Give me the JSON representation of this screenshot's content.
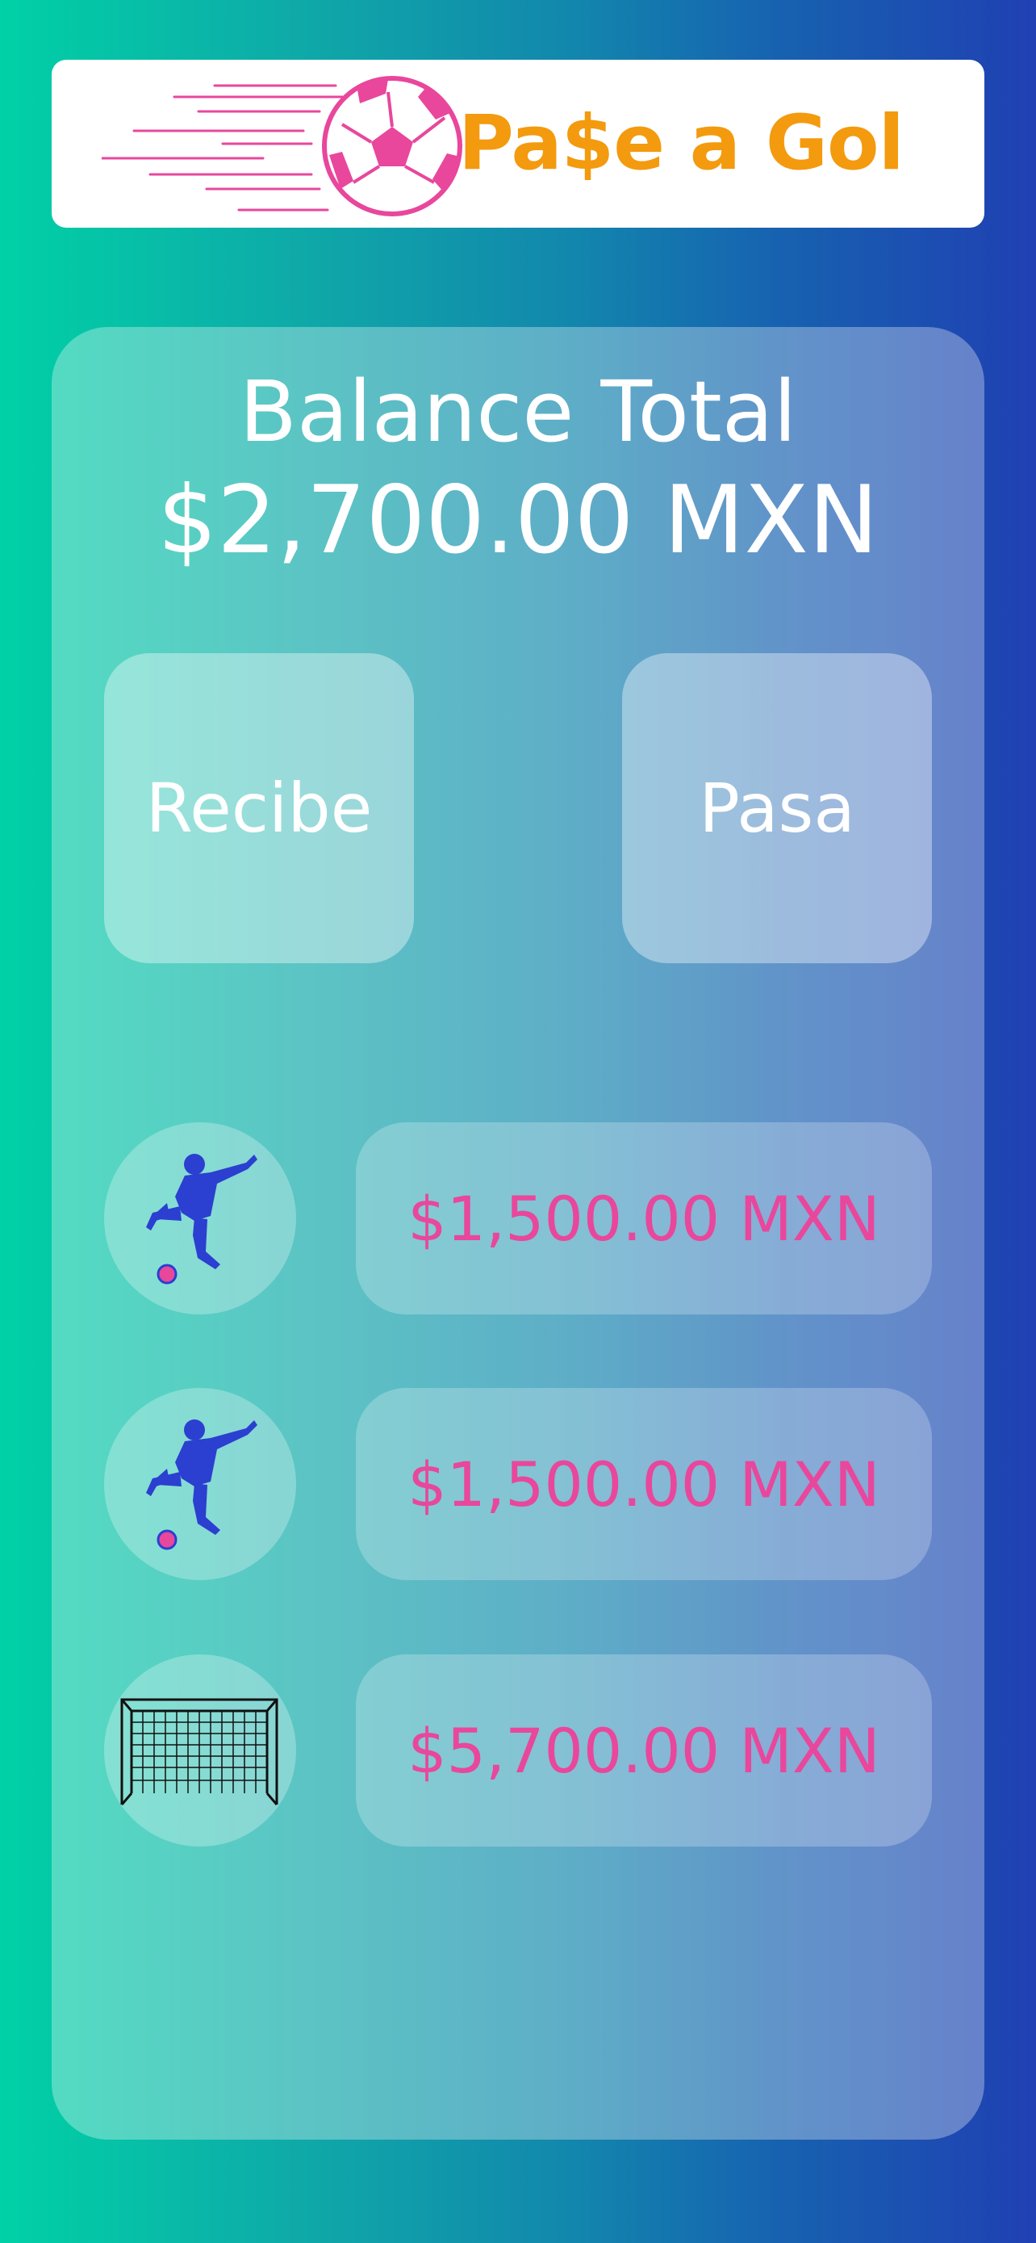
{
  "app": {
    "name": "Pa$e a Gol",
    "brand_color": "#f39a0f",
    "accent_pink": "#e8479c",
    "logo_icon": "soccer-ball-speed-icon"
  },
  "balance": {
    "title": "Balance Total",
    "amount": "$2,700.00 MXN"
  },
  "actions": [
    {
      "label": "Recibe"
    },
    {
      "label": "Pasa"
    }
  ],
  "transactions": [
    {
      "icon": "soccer-player-kick-icon",
      "amount": "$1,500.00 MXN"
    },
    {
      "icon": "soccer-player-kick-icon",
      "amount": "$1,500.00 MXN"
    },
    {
      "icon": "soccer-goal-net-icon",
      "amount": "$5,700.00 MXN"
    }
  ]
}
